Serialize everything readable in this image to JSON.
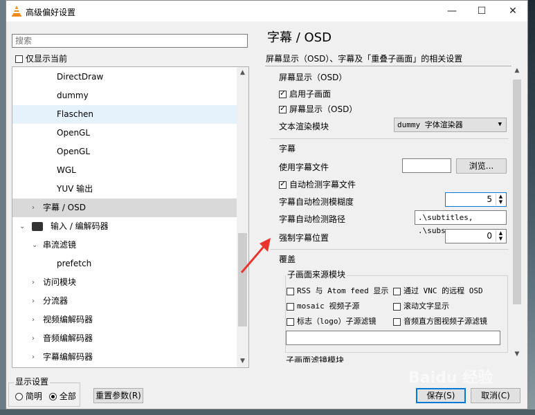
{
  "window": {
    "title": "高级偏好设置",
    "minimize": "—",
    "maximize": "☐",
    "close": "✕"
  },
  "search": {
    "placeholder": "搜索"
  },
  "show_current": {
    "label": "仅显示当前",
    "checked": false
  },
  "tree": {
    "items": [
      {
        "label": "DirectDraw",
        "level": 3,
        "arrow": ""
      },
      {
        "label": "dummy",
        "level": 3,
        "arrow": ""
      },
      {
        "label": "Flaschen",
        "level": 3,
        "arrow": "",
        "hover": true
      },
      {
        "label": "OpenGL",
        "level": 3,
        "arrow": ""
      },
      {
        "label": "OpenGL",
        "level": 3,
        "arrow": ""
      },
      {
        "label": "WGL",
        "level": 3,
        "arrow": ""
      },
      {
        "label": "YUV 输出",
        "level": 3,
        "arrow": ""
      },
      {
        "label": "字幕 / OSD",
        "level": 2,
        "arrow": "›",
        "selected": true
      },
      {
        "label": "输入 / 编解码器",
        "level": 1,
        "arrow": "⌄",
        "icon": true
      },
      {
        "label": "串流滤镜",
        "level": 2,
        "arrow": "⌄"
      },
      {
        "label": "prefetch",
        "level": 3,
        "arrow": ""
      },
      {
        "label": "访问模块",
        "level": 2,
        "arrow": "›"
      },
      {
        "label": "分流器",
        "level": 2,
        "arrow": "›"
      },
      {
        "label": "视频编解码器",
        "level": 2,
        "arrow": "›"
      },
      {
        "label": "音频编解码器",
        "level": 2,
        "arrow": "›"
      },
      {
        "label": "字幕编解码器",
        "level": 2,
        "arrow": "›"
      }
    ]
  },
  "display_settings": {
    "title": "显示设置",
    "simple": "简明",
    "all": "全部",
    "selected": "all"
  },
  "reset_button": "重置参数(R)",
  "save_button": "保存(S)",
  "cancel_button": "取消(C)",
  "panel": {
    "title": "字幕 / OSD",
    "description": "屏幕显示（OSD）、字幕及「重叠子画面」的相关设置",
    "osd_section": {
      "title": "屏幕显示（OSD）",
      "enable_subpictures": {
        "label": "启用子画面",
        "checked": true
      },
      "on_screen_display": {
        "label": "屏幕显示（OSD）",
        "checked": true
      },
      "text_render_label": "文本渲染模块",
      "text_render_value": "dummy 字体渲染器"
    },
    "subtitles_section": {
      "title": "字幕",
      "use_file_label": "使用字幕文件",
      "use_file_value": "",
      "browse_button": "浏览...",
      "autodetect": {
        "label": "自动检测字幕文件",
        "checked": true
      },
      "fuzzy_label": "字幕自动检测模糊度",
      "fuzzy_value": "5",
      "paths_label": "字幕自动检测路径",
      "paths_value": ".\\subtitles, .\\subs",
      "position_label": "强制字幕位置",
      "position_value": "0"
    },
    "overlay_section": {
      "title": "覆盖",
      "source_group_title": "子画面来源模块",
      "sources": [
        {
          "label": "RSS 与 Atom feed 显示",
          "checked": false
        },
        {
          "label": "通过 VNC 的远程 OSD",
          "checked": false
        },
        {
          "label": "mosaic 视频子源",
          "checked": false
        },
        {
          "label": "滚动文字显示",
          "checked": false
        },
        {
          "label": "标志（logo）子源滤镜",
          "checked": false
        },
        {
          "label": "音频直方图视频子源滤镜",
          "checked": false
        }
      ],
      "source_input_value": "",
      "filter_group_title": "子画面滤镜模块"
    }
  },
  "watermark": "Baidu 经验",
  "colors": {
    "accent": "#0078d7",
    "selected_row": "#d9d9d9",
    "arrow": "#e8352b",
    "vlc_orange": "#f08a1c"
  }
}
